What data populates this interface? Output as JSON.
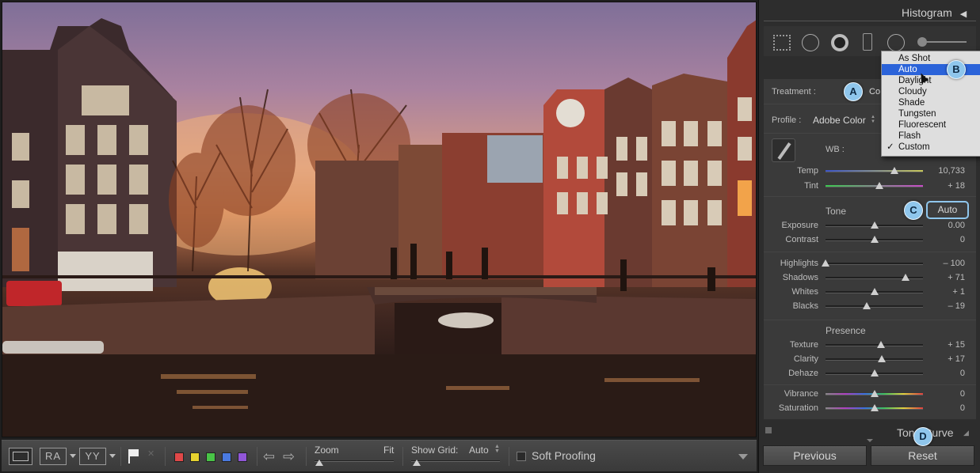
{
  "panel": {
    "histogram_title": "Histogram",
    "treatment": {
      "label": "Treatment :",
      "value": "Co"
    },
    "profile": {
      "label": "Profile :",
      "value": "Adobe Color"
    },
    "wb": {
      "label": "WB :",
      "temp": {
        "label": "Temp",
        "value": "10,733",
        "level": 0.71
      },
      "tint": {
        "label": "Tint",
        "value": "+ 18",
        "level": 0.55
      }
    },
    "tone": {
      "title": "Tone",
      "auto_label": "Auto",
      "sliders": [
        {
          "label": "Exposure",
          "value": "0.00",
          "level": 0.5
        },
        {
          "label": "Contrast",
          "value": "0",
          "level": 0.5
        },
        {
          "label": "Highlights",
          "value": "– 100",
          "level": 0.0
        },
        {
          "label": "Shadows",
          "value": "+ 71",
          "level": 0.82
        },
        {
          "label": "Whites",
          "value": "+ 1",
          "level": 0.5
        },
        {
          "label": "Blacks",
          "value": "– 19",
          "level": 0.42
        }
      ]
    },
    "presence": {
      "title": "Presence",
      "sliders": [
        {
          "label": "Texture",
          "value": "+ 15",
          "level": 0.57
        },
        {
          "label": "Clarity",
          "value": "+ 17",
          "level": 0.58
        },
        {
          "label": "Dehaze",
          "value": "0",
          "level": 0.5
        },
        {
          "label": "Vibrance",
          "value": "0",
          "level": 0.5
        },
        {
          "label": "Saturation",
          "value": "0",
          "level": 0.5
        }
      ]
    },
    "tone_curve_title": "Tone Curve",
    "previous_label": "Previous",
    "reset_label": "Reset"
  },
  "wb_dropdown": {
    "items": [
      "As Shot",
      "Auto",
      "Daylight",
      "Cloudy",
      "Shade",
      "Tungsten",
      "Fluorescent",
      "Flash",
      "Custom"
    ],
    "highlighted": "Auto",
    "checked": "Custom",
    "check_mark": "✓"
  },
  "callouts": {
    "a": "A",
    "b": "B",
    "c": "C",
    "d": "D"
  },
  "toolbar": {
    "view_a": "RA",
    "view_b": "YY",
    "zoom_label": "Zoom",
    "zoom_value": "Fit",
    "show_grid_label": "Show Grid:",
    "show_grid_value": "Auto",
    "soft_proofing_label": "Soft Proofing",
    "color_labels": [
      "#e04848",
      "#e6d22f",
      "#49c447",
      "#4a7ae0",
      "#9156d8"
    ]
  }
}
